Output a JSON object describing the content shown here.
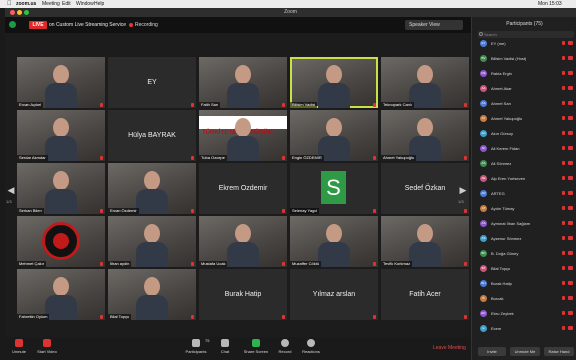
{
  "menubar": {
    "app": "zoom.us",
    "items": [
      "Meeting",
      "Edit",
      "Window",
      "Help"
    ],
    "clock": "Mon 15:03"
  },
  "window": {
    "title": "Zoom"
  },
  "topstrip": {
    "live": "LIVE",
    "stream": "on Custom Live Streaming Service",
    "recording": "Recording",
    "view": "Speaker View"
  },
  "gallery": {
    "tiles": [
      {
        "name": "Ercan Açıkel",
        "kind": "video"
      },
      {
        "name": "EY",
        "kind": "name"
      },
      {
        "name": "Fatih Sarı",
        "kind": "video"
      },
      {
        "name": "Bilisim Vadisi",
        "kind": "video",
        "active": true
      },
      {
        "name": "Teknopark Canlı",
        "kind": "video"
      },
      {
        "name": "Serdar Akmdar",
        "kind": "video"
      },
      {
        "name": "Hülya BAYRAK",
        "kind": "name"
      },
      {
        "name": "Tuba Ozcepe",
        "kind": "video",
        "banner": "TÜRKİYE'NİN DÖNÜŞÜM"
      },
      {
        "name": "Engin ÖZDEMİR",
        "kind": "video"
      },
      {
        "name": "Ahmet Yakupoğlu",
        "kind": "video"
      },
      {
        "name": "Serkan Bilen",
        "kind": "video"
      },
      {
        "name": "Ercan Özdemir",
        "kind": "video"
      },
      {
        "name": "Ekrem Ozdemir",
        "kind": "name"
      },
      {
        "name": "Selenay Yagci",
        "kind": "avatar",
        "letter": "S"
      },
      {
        "name": "Sedef Özkan",
        "kind": "name"
      },
      {
        "name": "Mehmet Çakır",
        "kind": "sharingan"
      },
      {
        "name": "İlhan aydin",
        "kind": "video"
      },
      {
        "name": "Mustafa Ucak",
        "kind": "video"
      },
      {
        "name": "Muzaffer Cöktü",
        "kind": "video"
      },
      {
        "name": "Tevfik Korkmaz",
        "kind": "video"
      },
      {
        "name": "Fahrettin Oylum",
        "kind": "video"
      },
      {
        "name": "Bilal Topçu",
        "kind": "video"
      },
      {
        "name": "Burak Hatip",
        "kind": "name"
      },
      {
        "name": "Yılmaz arslan",
        "kind": "name"
      },
      {
        "name": "Fatih Acer",
        "kind": "name"
      }
    ],
    "page_left": "1/3",
    "page_right": "1/3"
  },
  "toolbar": {
    "unmute": "Unmute",
    "start_video": "Start Video",
    "participants": "Participants",
    "participants_count": "75",
    "chat": "Chat",
    "share": "Share Screen",
    "record": "Record",
    "reactions": "Reactions",
    "leave": "Leave Meeting"
  },
  "panel": {
    "title": "Participants (75)",
    "search_placeholder": "Search",
    "participants": [
      {
        "initials": "EY",
        "name": "EY (me)",
        "color": "#4b7bd4"
      },
      {
        "initials": "BV",
        "name": "Bilisim Vadisi (Host)",
        "color": "#3f8c4f"
      },
      {
        "initials": "RE",
        "name": "Rabia Ergin",
        "color": "#8a56c9"
      },
      {
        "initials": "AA",
        "name": "Ahmet Akar",
        "color": "#c9567a"
      },
      {
        "initials": "AS",
        "name": "Ahmet Sarı",
        "color": "#4b7bd4"
      },
      {
        "initials": "AY",
        "name": "Ahmet Yakupoğlu",
        "color": "#c97b3d"
      },
      {
        "initials": "AG",
        "name": "Akın Gürsoy",
        "color": "#3d9ec9"
      },
      {
        "initials": "AK",
        "name": "Ali Kerem Fidan",
        "color": "#8a56c9"
      },
      {
        "initials": "AS",
        "name": "Ali Sönmez",
        "color": "#3f8c4f"
      },
      {
        "initials": "AE",
        "name": "Alp Eren Yurtseven",
        "color": "#c9567a"
      },
      {
        "initials": "AR",
        "name": "ARTEG",
        "color": "#4b7bd4"
      },
      {
        "initials": "AT",
        "name": "Aydın Tümay",
        "color": "#c97b3d"
      },
      {
        "initials": "AS",
        "name": "Aymınat İlhan Sağlam",
        "color": "#8a56c9"
      },
      {
        "initials": "AS",
        "name": "Aysenur Sönmez",
        "color": "#3d9ec9"
      },
      {
        "initials": "BD",
        "name": "B. Doğa Güney",
        "color": "#3f8c4f"
      },
      {
        "initials": "BT",
        "name": "Bilal Topçu",
        "color": "#c9567a"
      },
      {
        "initials": "BH",
        "name": "Burak Hatip",
        "color": "#4b7bd4"
      },
      {
        "initials": "B",
        "name": "Burcak",
        "color": "#c97b3d"
      },
      {
        "initials": "ED",
        "name": "Ebru Zeybek",
        "color": "#8a56c9"
      },
      {
        "initials": "E",
        "name": "Ecem",
        "color": "#3d9ec9"
      }
    ],
    "invite": "Invite",
    "unmute_me": "Unmute Me",
    "raise_hand": "Raise Hand"
  }
}
